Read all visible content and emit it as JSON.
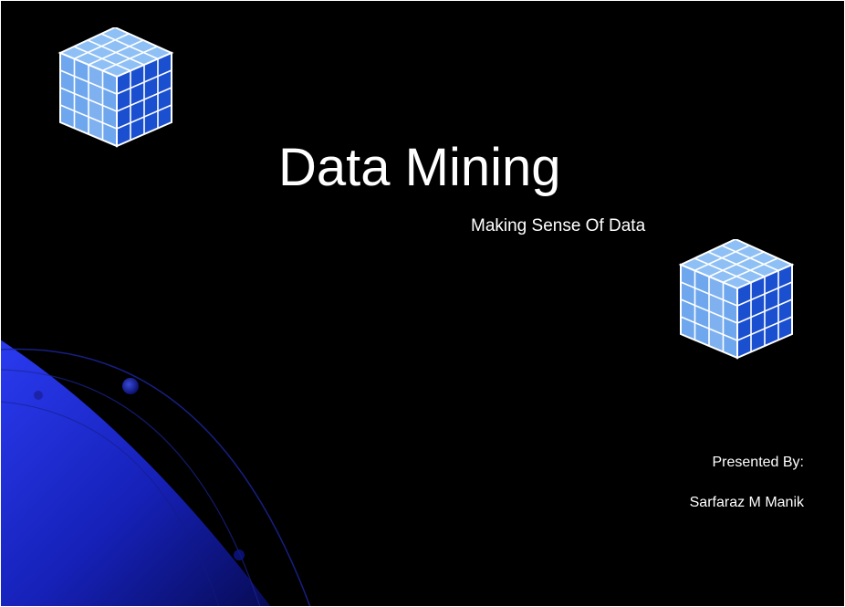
{
  "slide": {
    "title": "Data Mining",
    "subtitle": "Making Sense Of Data",
    "presented_by_label": "Presented By:",
    "presenter_name": "Sarfaraz M Manik"
  },
  "colors": {
    "background": "#000000",
    "text": "#ffffff",
    "accent_blue": "#1f2fd6",
    "cube_light": "#7db2f0",
    "cube_mid": "#4a86e0",
    "cube_dark": "#1646c6"
  },
  "decorations": {
    "cubes": [
      "data-cube-icon",
      "data-cube-icon"
    ],
    "corner_graphic": "blue-orbit-swoosh"
  }
}
